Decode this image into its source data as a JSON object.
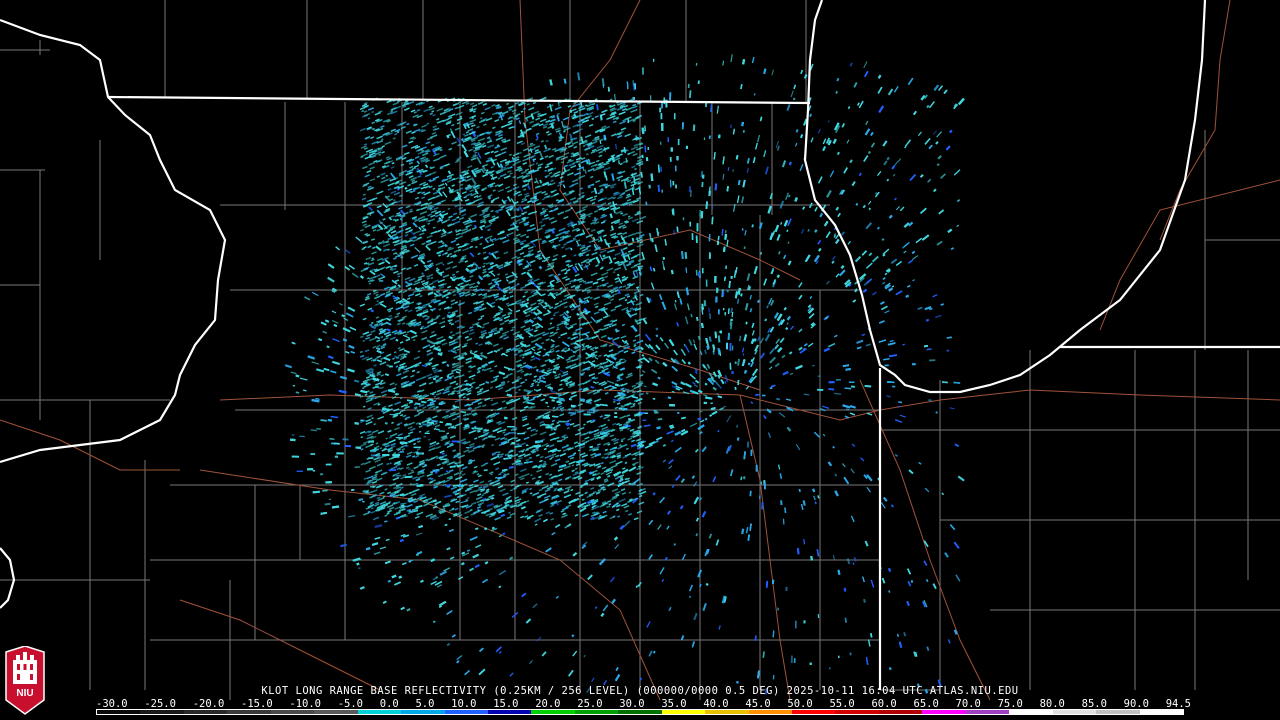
{
  "radar_site": "KLOT",
  "caption": "KLOT LONG RANGE BASE REFLECTIVITY (0.25KM / 256 LEVEL) (000000/0000 0.5 DEG) 2025-10-11 16:04 UTC  ATLAS.NIU.EDU",
  "scale": {
    "labels": [
      "-30.0",
      "-25.0",
      "-20.0",
      "-15.0",
      "-10.0",
      "-5.0",
      "0.0",
      "5.0",
      "10.0",
      "15.0",
      "20.0",
      "25.0",
      "30.0",
      "35.0",
      "40.0",
      "45.0",
      "50.0",
      "55.0",
      "60.0",
      "65.0",
      "70.0",
      "75.0",
      "80.0",
      "85.0",
      "90.0",
      "94.5"
    ],
    "colors": [
      "#0a0a0a",
      "#1a1a1a",
      "#2a2a2a",
      "#3a3a3a",
      "#4a4a4a",
      "#5a5a5a",
      "#00d0d8",
      "#00a8e8",
      "#2060ff",
      "#0000b0",
      "#00d000",
      "#00a000",
      "#007000",
      "#ffff00",
      "#e8c000",
      "#ff9000",
      "#ff0000",
      "#d00000",
      "#b00000",
      "#ff00ff",
      "#a040c0",
      "#ffffff",
      "#e0e0e0",
      "#c0c0c0",
      "#ffffff"
    ]
  },
  "logo_text": "NIU",
  "colors": {
    "background": "#000000",
    "state_border": "#ffffff",
    "county_border": "#7a7a7a",
    "roads": "#b0583a",
    "echo_light": "#3fd8e0",
    "echo_mid": "#2aa8e8",
    "echo_blue": "#2060ff"
  }
}
